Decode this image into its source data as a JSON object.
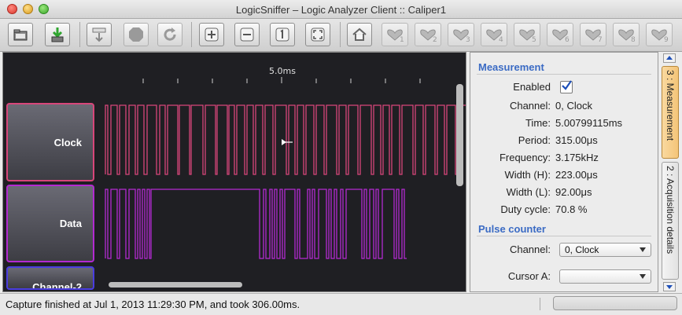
{
  "window": {
    "title": "LogicSniffer – Logic Analyzer Client :: Caliper1"
  },
  "toolbar": {
    "buttons": [
      {
        "name": "open-file",
        "icon": "folder-icon"
      },
      {
        "name": "save-file",
        "icon": "save-icon"
      },
      {
        "name": "capture",
        "icon": "capture-icon"
      },
      {
        "name": "stop",
        "icon": "stop-icon"
      },
      {
        "name": "repeat-capture",
        "icon": "refresh-icon"
      },
      {
        "name": "zoom-in",
        "icon": "zoom-in-icon"
      },
      {
        "name": "zoom-out",
        "icon": "zoom-out-icon"
      },
      {
        "name": "zoom-original",
        "icon": "zoom-1to1-icon"
      },
      {
        "name": "zoom-fit",
        "icon": "zoom-fit-icon"
      },
      {
        "name": "goto-trigger",
        "icon": "home-icon"
      }
    ],
    "cursor_buttons": [
      "1",
      "2",
      "3",
      "4",
      "5",
      "6",
      "7",
      "8",
      "9"
    ]
  },
  "timeline": {
    "label": "5.0ms"
  },
  "channels": [
    {
      "label": "Clock",
      "color": "#d8467a"
    },
    {
      "label": "Data",
      "color": "#b32ad1"
    },
    {
      "label": "Channel-2",
      "color": "#4a3de0"
    }
  ],
  "measurement": {
    "section_title": "Measurement",
    "enabled_label": "Enabled",
    "rows": [
      {
        "label": "Channel:",
        "value": "0, Clock"
      },
      {
        "label": "Time:",
        "value": "5.00799115ms"
      },
      {
        "label": "Period:",
        "value": "315.00μs"
      },
      {
        "label": "Frequency:",
        "value": "3.175kHz"
      },
      {
        "label": "Width (H):",
        "value": "223.00μs"
      },
      {
        "label": "Width (L):",
        "value": "92.00μs"
      },
      {
        "label": "Duty cycle:",
        "value": "70.8 %"
      }
    ]
  },
  "pulse_counter": {
    "section_title": "Pulse counter",
    "channel_label": "Channel:",
    "channel_value": "0, Clock",
    "cursor_label": "Cursor A:",
    "cursor_value": ""
  },
  "side_tabs": {
    "measurement": "3 : Measurement",
    "acquisition": "2 : Acquisition details"
  },
  "status": {
    "text": "Capture finished at Jul 1, 2013 11:29:30 PM, and took 306.00ms."
  },
  "colors": {
    "accent": "#3b6bc4",
    "canvas": "#1f1f23",
    "clock": "#d8467a",
    "data": "#b32ad1"
  }
}
